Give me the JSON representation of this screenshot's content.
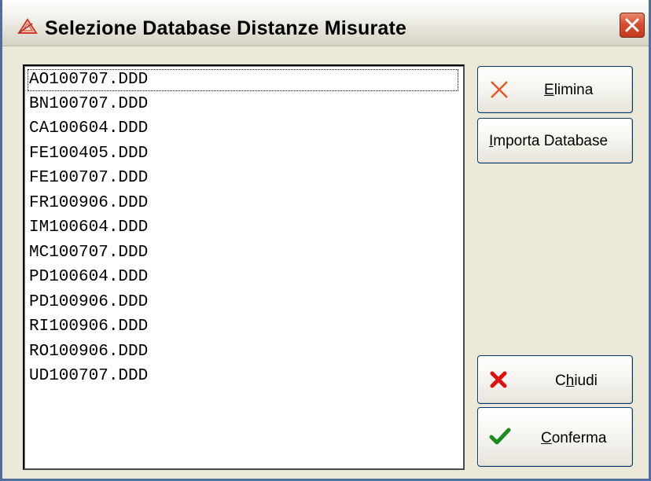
{
  "window": {
    "title": "Selezione Database Distanze Misurate",
    "icon": "app-triangle-icon",
    "close_icon": "close-icon"
  },
  "list": {
    "items": [
      "AO100707.DDD",
      "BN100707.DDD",
      "CA100604.DDD",
      "FE100405.DDD",
      "FE100707.DDD",
      "FR100906.DDD",
      "IM100604.DDD",
      "MC100707.DDD",
      "PD100604.DDD",
      "PD100906.DDD",
      "RI100906.DDD",
      "RO100906.DDD",
      "UD100707.DDD"
    ],
    "focused_index": 0
  },
  "buttons": {
    "elimina": {
      "mnemonic": "E",
      "rest": "limina",
      "icon": "delete-x-icon"
    },
    "importa": {
      "mnemonic": "I",
      "rest": "mporta Database"
    },
    "chiudi": {
      "pre": "C",
      "mnemonic": "h",
      "rest": "iudi",
      "icon": "close-red-x-icon"
    },
    "conferma": {
      "mnemonic": "C",
      "rest": "onferma",
      "icon": "checkmark-icon"
    }
  },
  "colors": {
    "titlebar_border": "#4f6e9e",
    "close_red": "#d5502f",
    "delete_orange": "#e8562a",
    "cancel_red": "#e01010",
    "confirm_green": "#1f8a1f"
  }
}
